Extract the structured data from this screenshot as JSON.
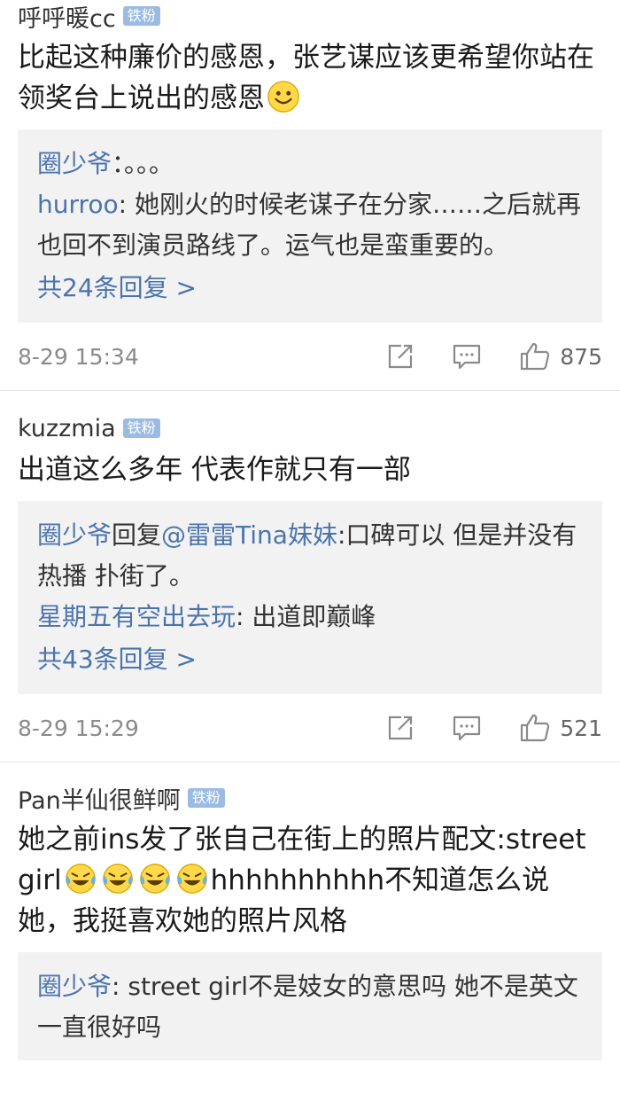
{
  "comments": [
    {
      "username": "呼呼暖cc",
      "badge": "铁粉",
      "text": "比起这种廉价的感恩，张艺谋应该更希望你站在领奖台上说出的感恩",
      "replies": [
        {
          "user": "圈少爷",
          "text": "：。。。"
        },
        {
          "user": "hurroo",
          "text": ": 她刚火的时候老谋子在分家……之后就再也回不到演员路线了。运气也是蛮重要的。"
        }
      ],
      "more": "共24条回复 >",
      "time": "8-29 15:34",
      "likes": "875"
    },
    {
      "username": "kuzzmia",
      "badge": "铁粉",
      "text": "出道这么多年 代表作就只有一部",
      "replies": [
        {
          "user": "圈少爷",
          "plain": "回复",
          "mention": "@雷雷Tina妹妹",
          "text": ":口碑可以 但是并没有热播 扑街了。"
        },
        {
          "user": "星期五有空出去玩",
          "text": ": 出道即巅峰"
        }
      ],
      "more": "共43条回复 >",
      "time": "8-29 15:29",
      "likes": "521"
    },
    {
      "username": "Pan半仙很鲜啊",
      "badge": "铁粉",
      "text_before": "她之前ins发了张自己在街上的照片配文:street girl",
      "text_after": "hhhhhhhhhh不知道怎么说她，我挺喜欢她的照片风格",
      "replies": [
        {
          "user": "圈少爷",
          "text": ": street girl不是妓女的意思吗 她不是英文一直很好吗"
        }
      ]
    }
  ],
  "icons": {
    "share": "share-icon",
    "comment": "comment-icon",
    "like": "thumbs-up-icon",
    "smile": "smile-emoji",
    "laugh_cry": "laugh-cry-emoji"
  },
  "colors": {
    "link_blue": "#4a74ad",
    "badge_blue": "#9bbbe3",
    "reply_bg": "#f2f2f2"
  }
}
